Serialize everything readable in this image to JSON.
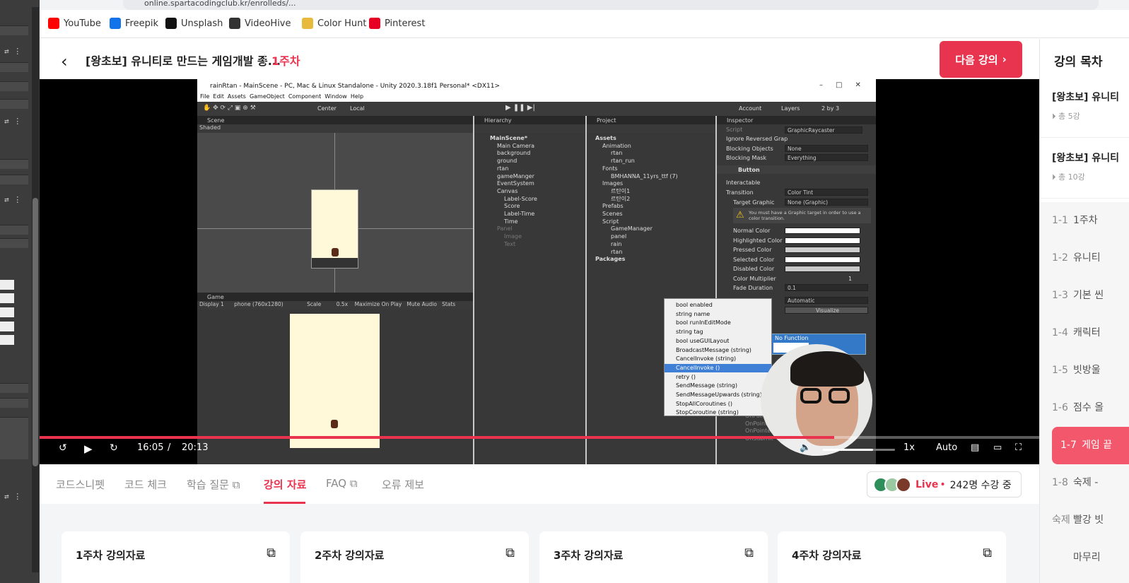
{
  "browser": {
    "url": "online.spartacodingclub.kr/enrolleds/...",
    "bookmarks": [
      {
        "label": "YouTube",
        "icon": "youtube-icon",
        "color": "#ff0000"
      },
      {
        "label": "Freepik",
        "icon": "freepik-icon",
        "color": "#1273eb"
      },
      {
        "label": "Unsplash",
        "icon": "unsplash-icon",
        "color": "#111111"
      },
      {
        "label": "VideoHive",
        "icon": "videohive-icon",
        "color": "#333333"
      },
      {
        "label": "Color Hunt",
        "icon": "colorhunt-icon",
        "color": "#e7b93c"
      },
      {
        "label": "Pinterest",
        "icon": "pinterest-icon",
        "color": "#e60023"
      }
    ]
  },
  "header": {
    "course_title": "[왕초보] 유니티로 만드는 게임개발 종...",
    "week": "1주차",
    "next_label": "다음 강의"
  },
  "unity": {
    "title": "rainRtan - MainScene - PC, Mac & Linux Standalone - Unity 2020.3.18f1 Personal* <DX11>",
    "menu": [
      "File",
      "Edit",
      "Assets",
      "GameObject",
      "Component",
      "Window",
      "Help"
    ],
    "scene_tab": "Scene",
    "game_tab": "Game",
    "shaded": "Shaded",
    "display": "Display 1",
    "resolution": "phone (760x1280)",
    "scale": "Scale",
    "scale_value": "0.5x",
    "maximize": "Maximize On Play",
    "mute": "Mute Audio",
    "stats": "Stats",
    "hierarchy_tab": "Hierarchy",
    "hierarchy": [
      "MainScene*",
      "Main Camera",
      "background",
      "ground",
      "rtan",
      "gameManger",
      "EventSystem",
      "Canvas",
      "Label-Score",
      "Score",
      "Label-Time",
      "Time",
      "Panel",
      "Image",
      "Text"
    ],
    "project_tab": "Project",
    "project": [
      "Assets",
      "Animation",
      "rtan",
      "rtan_run",
      "Fonts",
      "BMHANNA_11yrs_ttf (7)",
      "Images",
      "르탄이1",
      "르탄이2",
      "Prefabs",
      "Scenes",
      "Script",
      "GameManager",
      "panel",
      "rain",
      "rtan",
      "Packages"
    ],
    "inspector_tab": "Inspector",
    "account": "Account",
    "layers": "Layers",
    "layout": "2 by 3",
    "center": "Center",
    "local": "Local",
    "inspector": {
      "script_label": "Script",
      "script_value": "GraphicRaycaster",
      "ignore_label": "Ignore Reversed Grap",
      "blocking_objects": "Blocking Objects",
      "blocking_objects_value": "None",
      "blocking_mask": "Blocking Mask",
      "blocking_mask_value": "Everything",
      "component": "Button",
      "interactable": "Interactable",
      "transition": "Transition",
      "transition_value": "Color Tint",
      "target_graphic": "Target Graphic",
      "target_graphic_value": "None (Graphic)",
      "warning": "You must have a Graphic target in order to use a color transition.",
      "normal": "Normal Color",
      "highlighted": "Highlighted Color",
      "pressed": "Pressed Color",
      "selected": "Selected Color",
      "disabled": "Disabled Color",
      "multiplier": "Color Multiplier",
      "multiplier_value": "1",
      "fade": "Fade Duration",
      "fade_value": "0.1",
      "navigation_value": "Automatic",
      "visualize": "Visualize",
      "no_function": "No Function"
    },
    "dropdown": [
      "bool enabled",
      "string name",
      "bool runInEditMode",
      "string tag",
      "bool useGUILayout",
      "BroadcastMessage (string)",
      "CancelInvoke (string)",
      "CancelInvoke ()",
      "retry ()",
      "SendMessage (string)",
      "SendMessageUpwards (string)",
      "StopAllCoroutines ()",
      "StopCoroutine (string)"
    ],
    "dropdown_selected": 7,
    "events": [
      "OnPointe",
      "OnPointer",
      "OnPointer",
      "OnSubmit"
    ]
  },
  "player": {
    "current": "16:05",
    "slash": "/",
    "duration": "20:13",
    "progress": 0.795,
    "volume": 0.7,
    "speed": "1x",
    "quality": "Auto"
  },
  "tabs": [
    {
      "label": "코드스니펫",
      "ext": false
    },
    {
      "label": "코드 체크",
      "ext": false
    },
    {
      "label": "학습 질문",
      "ext": true
    },
    {
      "label": "강의 자료",
      "ext": false,
      "active": true
    },
    {
      "label": "FAQ",
      "ext": true
    },
    {
      "label": "오류 제보",
      "ext": false
    }
  ],
  "live": {
    "word": "Live",
    "dot": "•",
    "count": "242명 수강 중"
  },
  "cards": [
    "1주차 강의자료",
    "2주차 강의자료",
    "3주차 강의자료",
    "4주차 강의자료"
  ],
  "sidebar": {
    "title": "강의 목차",
    "sections": [
      {
        "title": "[왕초보] 유니티",
        "sub": "총 5강"
      },
      {
        "title": "[왕초보] 유니티",
        "sub": "총 10강"
      }
    ],
    "items": [
      {
        "num": "1-1",
        "label": "1주차"
      },
      {
        "num": "1-2",
        "label": "유니티"
      },
      {
        "num": "1-3",
        "label": "기본 씬"
      },
      {
        "num": "1-4",
        "label": "캐릭터"
      },
      {
        "num": "1-5",
        "label": "빗방울"
      },
      {
        "num": "1-6",
        "label": "점수 올"
      },
      {
        "num": "1-7",
        "label": "게임 끝",
        "active": true
      },
      {
        "num": "1-8",
        "label": "숙제 -"
      },
      {
        "num": "숙제",
        "label": "빨강 빗"
      },
      {
        "num": "",
        "label": "마무리"
      }
    ]
  }
}
